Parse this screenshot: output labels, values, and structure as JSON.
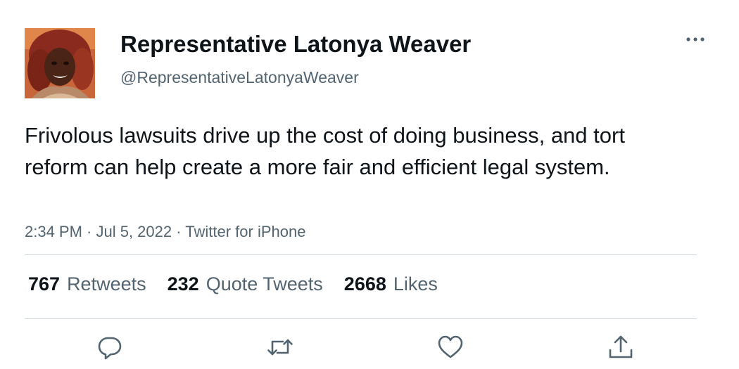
{
  "author": {
    "display_name": "Representative Latonya Weaver",
    "handle": "@RepresentativeLatonyaWeaver"
  },
  "tweet": {
    "text": "Frivolous lawsuits drive up the cost of doing business, and tort reform can help create a more fair and efficient legal system.",
    "meta": "2:34 PM · Jul 5, 2022 · Twitter for iPhone"
  },
  "stats": {
    "retweets_count": "767",
    "retweets_label": "Retweets",
    "quotes_count": "232",
    "quotes_label": "Quote Tweets",
    "likes_count": "2668",
    "likes_label": "Likes"
  },
  "icons": {
    "more": "more-horizontal-icon",
    "reply": "reply-icon",
    "retweet": "retweet-icon",
    "like": "heart-icon",
    "share": "share-icon"
  },
  "colors": {
    "text": "#0f1419",
    "secondary": "#536471",
    "divider": "#cfd9de"
  }
}
